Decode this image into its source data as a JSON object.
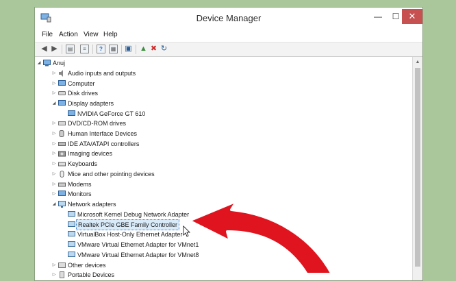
{
  "window": {
    "title": "Device Manager",
    "controls": {
      "minimize": "—",
      "maximize": "☐",
      "close": "✕"
    }
  },
  "menu": {
    "file": "File",
    "action": "Action",
    "view": "View",
    "help": "Help"
  },
  "tree": {
    "root": "Anuj",
    "items": [
      {
        "label": "Audio inputs and outputs",
        "icon": "speaker-icon",
        "expanded": false
      },
      {
        "label": "Computer",
        "icon": "computer-icon",
        "expanded": false
      },
      {
        "label": "Disk drives",
        "icon": "disk-drive-icon",
        "expanded": false
      },
      {
        "label": "Display adapters",
        "icon": "display-adapter-icon",
        "expanded": true,
        "children": [
          "NVIDIA GeForce GT 610"
        ]
      },
      {
        "label": "DVD/CD-ROM drives",
        "icon": "dvd-drive-icon",
        "expanded": false
      },
      {
        "label": "Human Interface Devices",
        "icon": "hid-icon",
        "expanded": false
      },
      {
        "label": "IDE ATA/ATAPI controllers",
        "icon": "ide-controller-icon",
        "expanded": false
      },
      {
        "label": "Imaging devices",
        "icon": "camera-icon",
        "expanded": false
      },
      {
        "label": "Keyboards",
        "icon": "keyboard-icon",
        "expanded": false
      },
      {
        "label": "Mice and other pointing devices",
        "icon": "mouse-icon",
        "expanded": false
      },
      {
        "label": "Modems",
        "icon": "modem-icon",
        "expanded": false
      },
      {
        "label": "Monitors",
        "icon": "monitor-icon",
        "expanded": false
      },
      {
        "label": "Network adapters",
        "icon": "network-adapter-icon",
        "expanded": true,
        "children": [
          "Microsoft Kernel Debug Network Adapter",
          "Realtek PCIe GBE Family Controller",
          "VirtualBox Host-Only Ethernet Adapter",
          "VMware Virtual Ethernet Adapter for VMnet1",
          "VMware Virtual Ethernet Adapter for VMnet8"
        ]
      },
      {
        "label": "Other devices",
        "icon": "other-devices-icon",
        "expanded": false
      },
      {
        "label": "Portable Devices",
        "icon": "portable-device-icon",
        "expanded": false
      }
    ],
    "selected": "Realtek PCIe GBE Family Controller"
  },
  "colors": {
    "background": "#a9c79a",
    "close_button": "#c75050",
    "arrow": "#e0141e",
    "selection": "#d9eaf9"
  }
}
